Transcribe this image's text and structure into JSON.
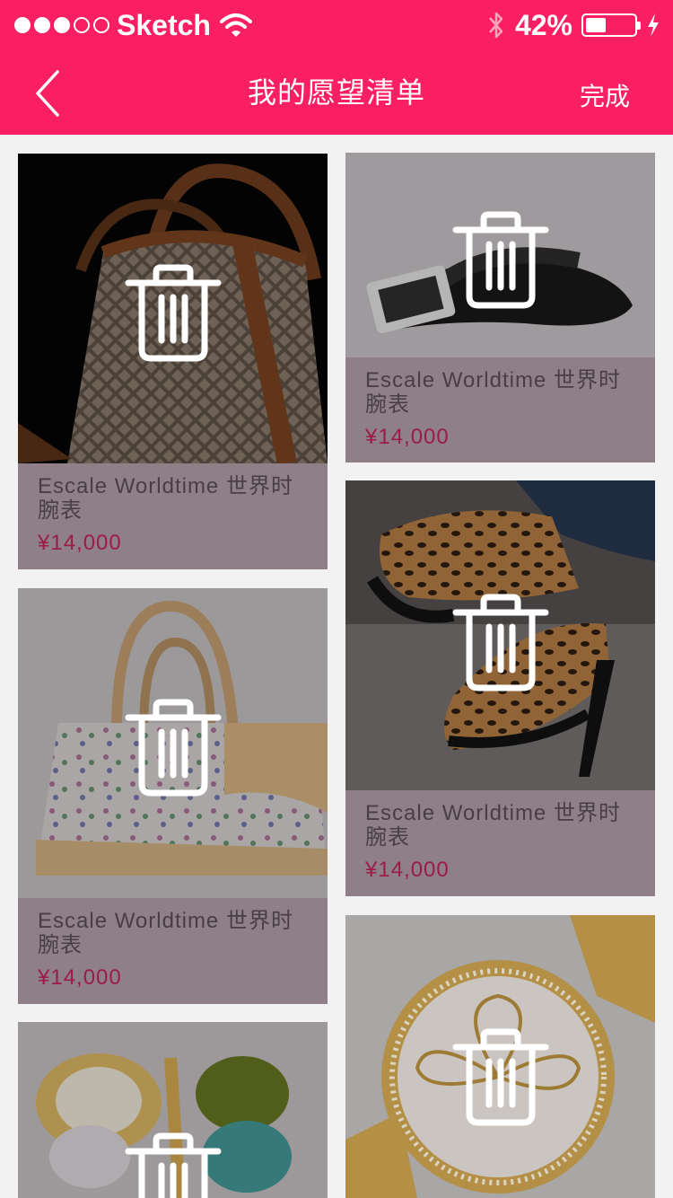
{
  "status_bar": {
    "carrier": "Sketch",
    "signal_full": 3,
    "signal_total": 5,
    "battery_percent": "42%",
    "battery_level": 0.42
  },
  "header": {
    "title": "我的愿望清单",
    "done_label": "完成",
    "background_color": "#fa1e63"
  },
  "colors": {
    "page_background": "#f2f2f2",
    "card_overlay": "#8e7f89",
    "price_color": "#9b1d45"
  },
  "products": [
    {
      "name": "Escale Worldtime 世界时腕表",
      "price": "¥14,000",
      "image": "checkered-handbag",
      "action_icon": "trash-icon"
    },
    {
      "name": "Escale Worldtime 世界时腕表",
      "price": "¥14,000",
      "image": "leather-belt",
      "action_icon": "trash-icon"
    },
    {
      "name": "Escale Worldtime 世界时腕表",
      "price": "¥14,000",
      "image": "monogram-handbag",
      "action_icon": "trash-icon"
    },
    {
      "name": "Escale Worldtime 世界时腕表",
      "price": "¥14,000",
      "image": "leopard-heels",
      "action_icon": "trash-icon"
    },
    {
      "name": "",
      "price": "",
      "image": "butterfly-brooch",
      "action_icon": "trash-icon"
    },
    {
      "name": "",
      "price": "",
      "image": "gold-watch",
      "action_icon": "trash-icon"
    }
  ]
}
